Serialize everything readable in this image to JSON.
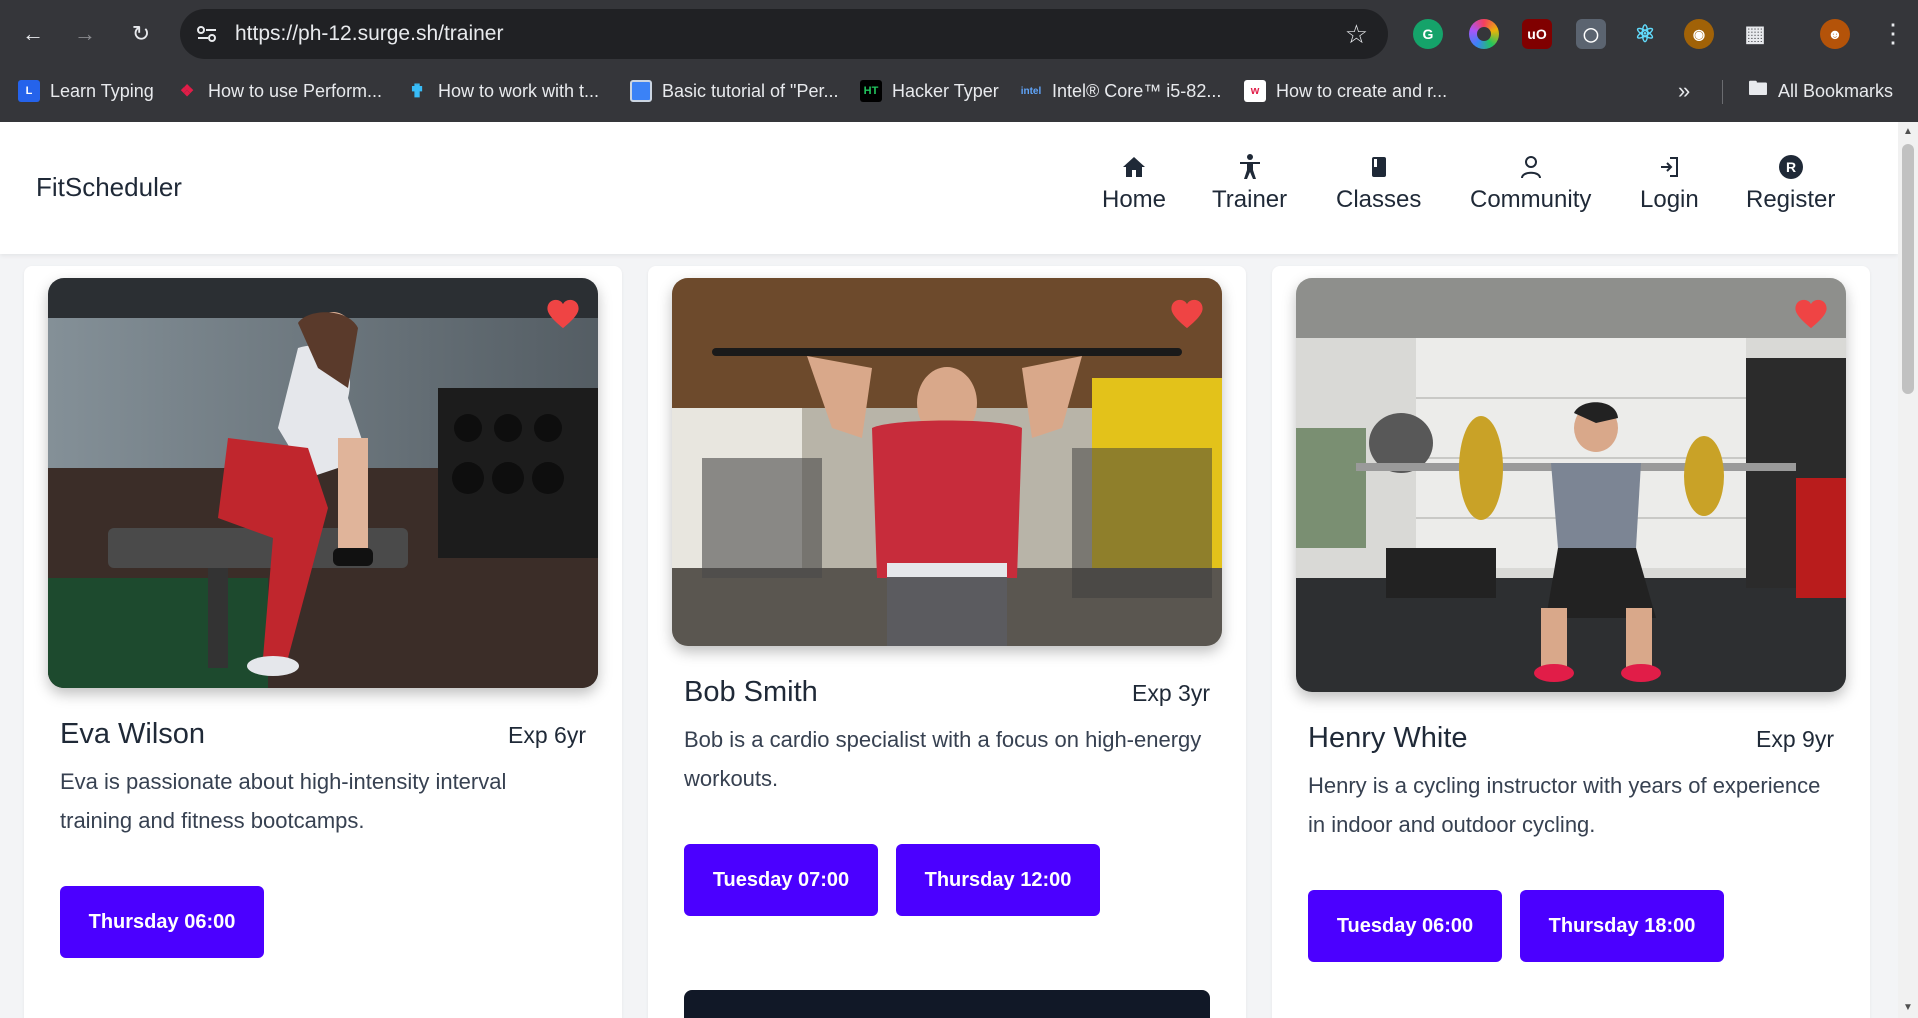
{
  "browser": {
    "url": "https://ph-12.surge.sh/trainer",
    "bookmarks": [
      {
        "label": "Learn Typing",
        "icon": "learn-typing-icon",
        "color": "#2563eb"
      },
      {
        "label": "How to use Perform...",
        "icon": "perform-icon",
        "color": "#e11d48"
      },
      {
        "label": "How to work with t...",
        "icon": "cross-icon",
        "color": "#38bdf8"
      },
      {
        "label": "Basic tutorial of \"Per...",
        "icon": "tutorial-icon",
        "color": "#3b82f6"
      },
      {
        "label": "Hacker Typer",
        "icon": "hacker-typer-icon",
        "color": "#111111"
      },
      {
        "label": "Intel® Core™ i5-82...",
        "icon": "intel-icon",
        "color": "#1d4ed8"
      },
      {
        "label": "How to create and r...",
        "icon": "create-icon",
        "color": "#ffffff"
      }
    ],
    "all_bookmarks_label": "All Bookmarks"
  },
  "site": {
    "brand": "FitScheduler",
    "nav": [
      {
        "label": "Home",
        "icon": "home-icon"
      },
      {
        "label": "Trainer",
        "icon": "trainer-icon"
      },
      {
        "label": "Classes",
        "icon": "book-icon"
      },
      {
        "label": "Community",
        "icon": "user-icon"
      },
      {
        "label": "Login",
        "icon": "login-icon"
      },
      {
        "label": "Register",
        "icon": "register-icon"
      }
    ]
  },
  "trainers": [
    {
      "name": "Eva Wilson",
      "experience": "Exp  6yr",
      "bio": "Eva is passionate about high-intensity interval training and fitness bootcamps.",
      "slots": [
        "Thursday 06:00"
      ]
    },
    {
      "name": "Bob Smith",
      "experience": "Exp  3yr",
      "bio": "Bob is a cardio specialist with a focus on high-energy workouts.",
      "slots": [
        "Tuesday 07:00",
        "Thursday 12:00"
      ]
    },
    {
      "name": "Henry White",
      "experience": "Exp  9yr",
      "bio": "Henry is a cycling instructor with years of experience in indoor and outdoor cycling.",
      "slots": [
        "Tuesday 06:00",
        "Thursday 18:00"
      ]
    }
  ],
  "colors": {
    "slot_button": "#4b00ff",
    "heart": "#ef4444",
    "chrome_bg": "#35363a"
  }
}
